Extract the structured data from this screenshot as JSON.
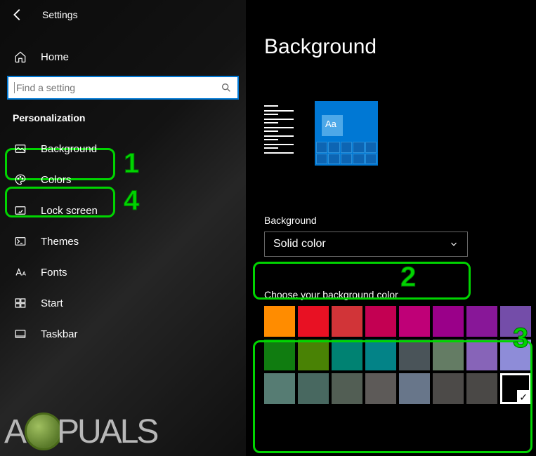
{
  "header": {
    "app_title": "Settings"
  },
  "home_label": "Home",
  "search": {
    "placeholder": "Find a setting"
  },
  "section_label": "Personalization",
  "nav": [
    {
      "icon": "picture-icon",
      "label": "Background"
    },
    {
      "icon": "palette-icon",
      "label": "Colors"
    },
    {
      "icon": "lockscreen-icon",
      "label": "Lock screen"
    },
    {
      "icon": "themes-icon",
      "label": "Themes"
    },
    {
      "icon": "fonts-icon",
      "label": "Fonts"
    },
    {
      "icon": "start-icon",
      "label": "Start"
    },
    {
      "icon": "taskbar-icon",
      "label": "Taskbar"
    }
  ],
  "main": {
    "title": "Background",
    "preview_sample": "Aa",
    "bg_label": "Background",
    "bg_value": "Solid color",
    "color_label": "Choose your background color",
    "swatches": [
      "#ff8c00",
      "#e81123",
      "#d13438",
      "#c30052",
      "#bf0077",
      "#9a0089",
      "#881798",
      "#744da9",
      "#107c10",
      "#498205",
      "#008272",
      "#038387",
      "#4a5459",
      "#647c64",
      "#8764b8",
      "#8e8cd8",
      "#567c73",
      "#486860",
      "#525e54",
      "#5d5a58",
      "#68768a",
      "#4c4a48",
      "#4a4846",
      "#000000"
    ],
    "selected_swatch_index": 23
  },
  "annotations": {
    "n1": "1",
    "n2": "2",
    "n3": "3",
    "n4": "4"
  },
  "watermark": "PUALS"
}
